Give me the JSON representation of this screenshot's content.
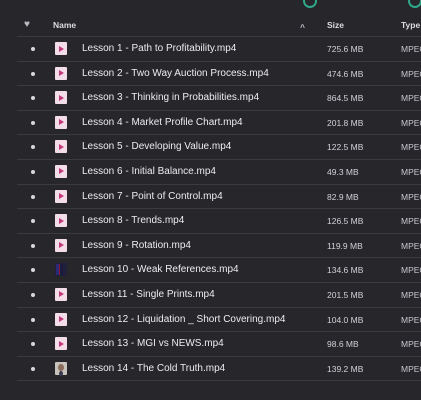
{
  "colors": {
    "background": "#26262b",
    "divider": "#3a3a41",
    "video_icon_accent": "#c33a7b",
    "top_icon_accent": "#2fa889"
  },
  "header": {
    "favorite_icon": "heart-icon",
    "name_label": "Name",
    "sort_indicator": "^",
    "size_label": "Size",
    "type_label": "Type"
  },
  "files": [
    {
      "name": "Lesson 1 - Path to Profitability.mp4",
      "size": "725.6 MB",
      "type": "MPEG",
      "icon": "video-file-icon"
    },
    {
      "name": "Lesson 2 - Two Way Auction Process.mp4",
      "size": "474.6 MB",
      "type": "MPEG",
      "icon": "video-file-icon"
    },
    {
      "name": "Lesson 3 - Thinking in Probabilities.mp4",
      "size": "864.5 MB",
      "type": "MPEG",
      "icon": "video-file-icon"
    },
    {
      "name": "Lesson 4 - Market Profile Chart.mp4",
      "size": "201.8 MB",
      "type": "MPEG",
      "icon": "video-file-icon"
    },
    {
      "name": "Lesson 5 - Developing Value.mp4",
      "size": "122.5 MB",
      "type": "MPEG",
      "icon": "video-file-icon"
    },
    {
      "name": "Lesson 6 - Initial Balance.mp4",
      "size": "49.3 MB",
      "type": "MPEG",
      "icon": "video-file-icon"
    },
    {
      "name": "Lesson 7 - Point of Control.mp4",
      "size": "82.9 MB",
      "type": "MPEG",
      "icon": "video-file-icon"
    },
    {
      "name": "Lesson 8 - Trends.mp4",
      "size": "126.5 MB",
      "type": "MPEG",
      "icon": "video-file-icon"
    },
    {
      "name": "Lesson 9 - Rotation.mp4",
      "size": "119.9 MB",
      "type": "MPEG",
      "icon": "video-file-icon"
    },
    {
      "name": "Lesson 10 - Weak References.mp4",
      "size": "134.6 MB",
      "type": "MPEG",
      "icon": "video-thumbnail-dark"
    },
    {
      "name": "Lesson 11 - Single Prints.mp4",
      "size": "201.5 MB",
      "type": "MPEG",
      "icon": "video-file-icon"
    },
    {
      "name": "Lesson 12 - Liquidation _ Short Covering.mp4",
      "size": "104.0 MB",
      "type": "MPEG",
      "icon": "video-file-icon"
    },
    {
      "name": "Lesson 13 - MGI vs NEWS.mp4",
      "size": "98.6 MB",
      "type": "MPEG",
      "icon": "video-file-icon"
    },
    {
      "name": "Lesson 14 - The Cold Truth.mp4",
      "size": "139.2 MB",
      "type": "MPEG",
      "icon": "video-thumbnail-face"
    }
  ]
}
